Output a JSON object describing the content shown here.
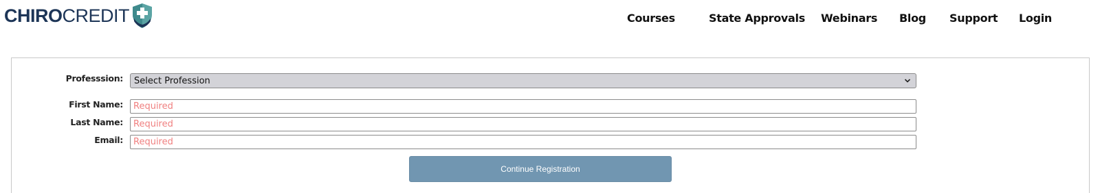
{
  "brand": {
    "name_bold": "CHIRO",
    "name_light": "CREDIT",
    "colors": {
      "primary": "#1d3557",
      "shield": "#5ba4a4"
    }
  },
  "nav": {
    "items": [
      {
        "label": "Courses"
      },
      {
        "label": "State Approvals"
      },
      {
        "label": "Webinars"
      },
      {
        "label": "Blog"
      },
      {
        "label": "Support"
      },
      {
        "label": "Login"
      }
    ]
  },
  "form": {
    "profession": {
      "label": "Professsion:",
      "selected": "Select Profession"
    },
    "first_name": {
      "label": "First Name:",
      "placeholder": "Required",
      "value": ""
    },
    "last_name": {
      "label": "Last Name:",
      "placeholder": "Required",
      "value": ""
    },
    "email": {
      "label": "Email:",
      "placeholder": "Required",
      "value": ""
    },
    "continue_label": "Continue Registration",
    "colors": {
      "button": "#7196b1",
      "placeholder": "#f08080"
    }
  }
}
